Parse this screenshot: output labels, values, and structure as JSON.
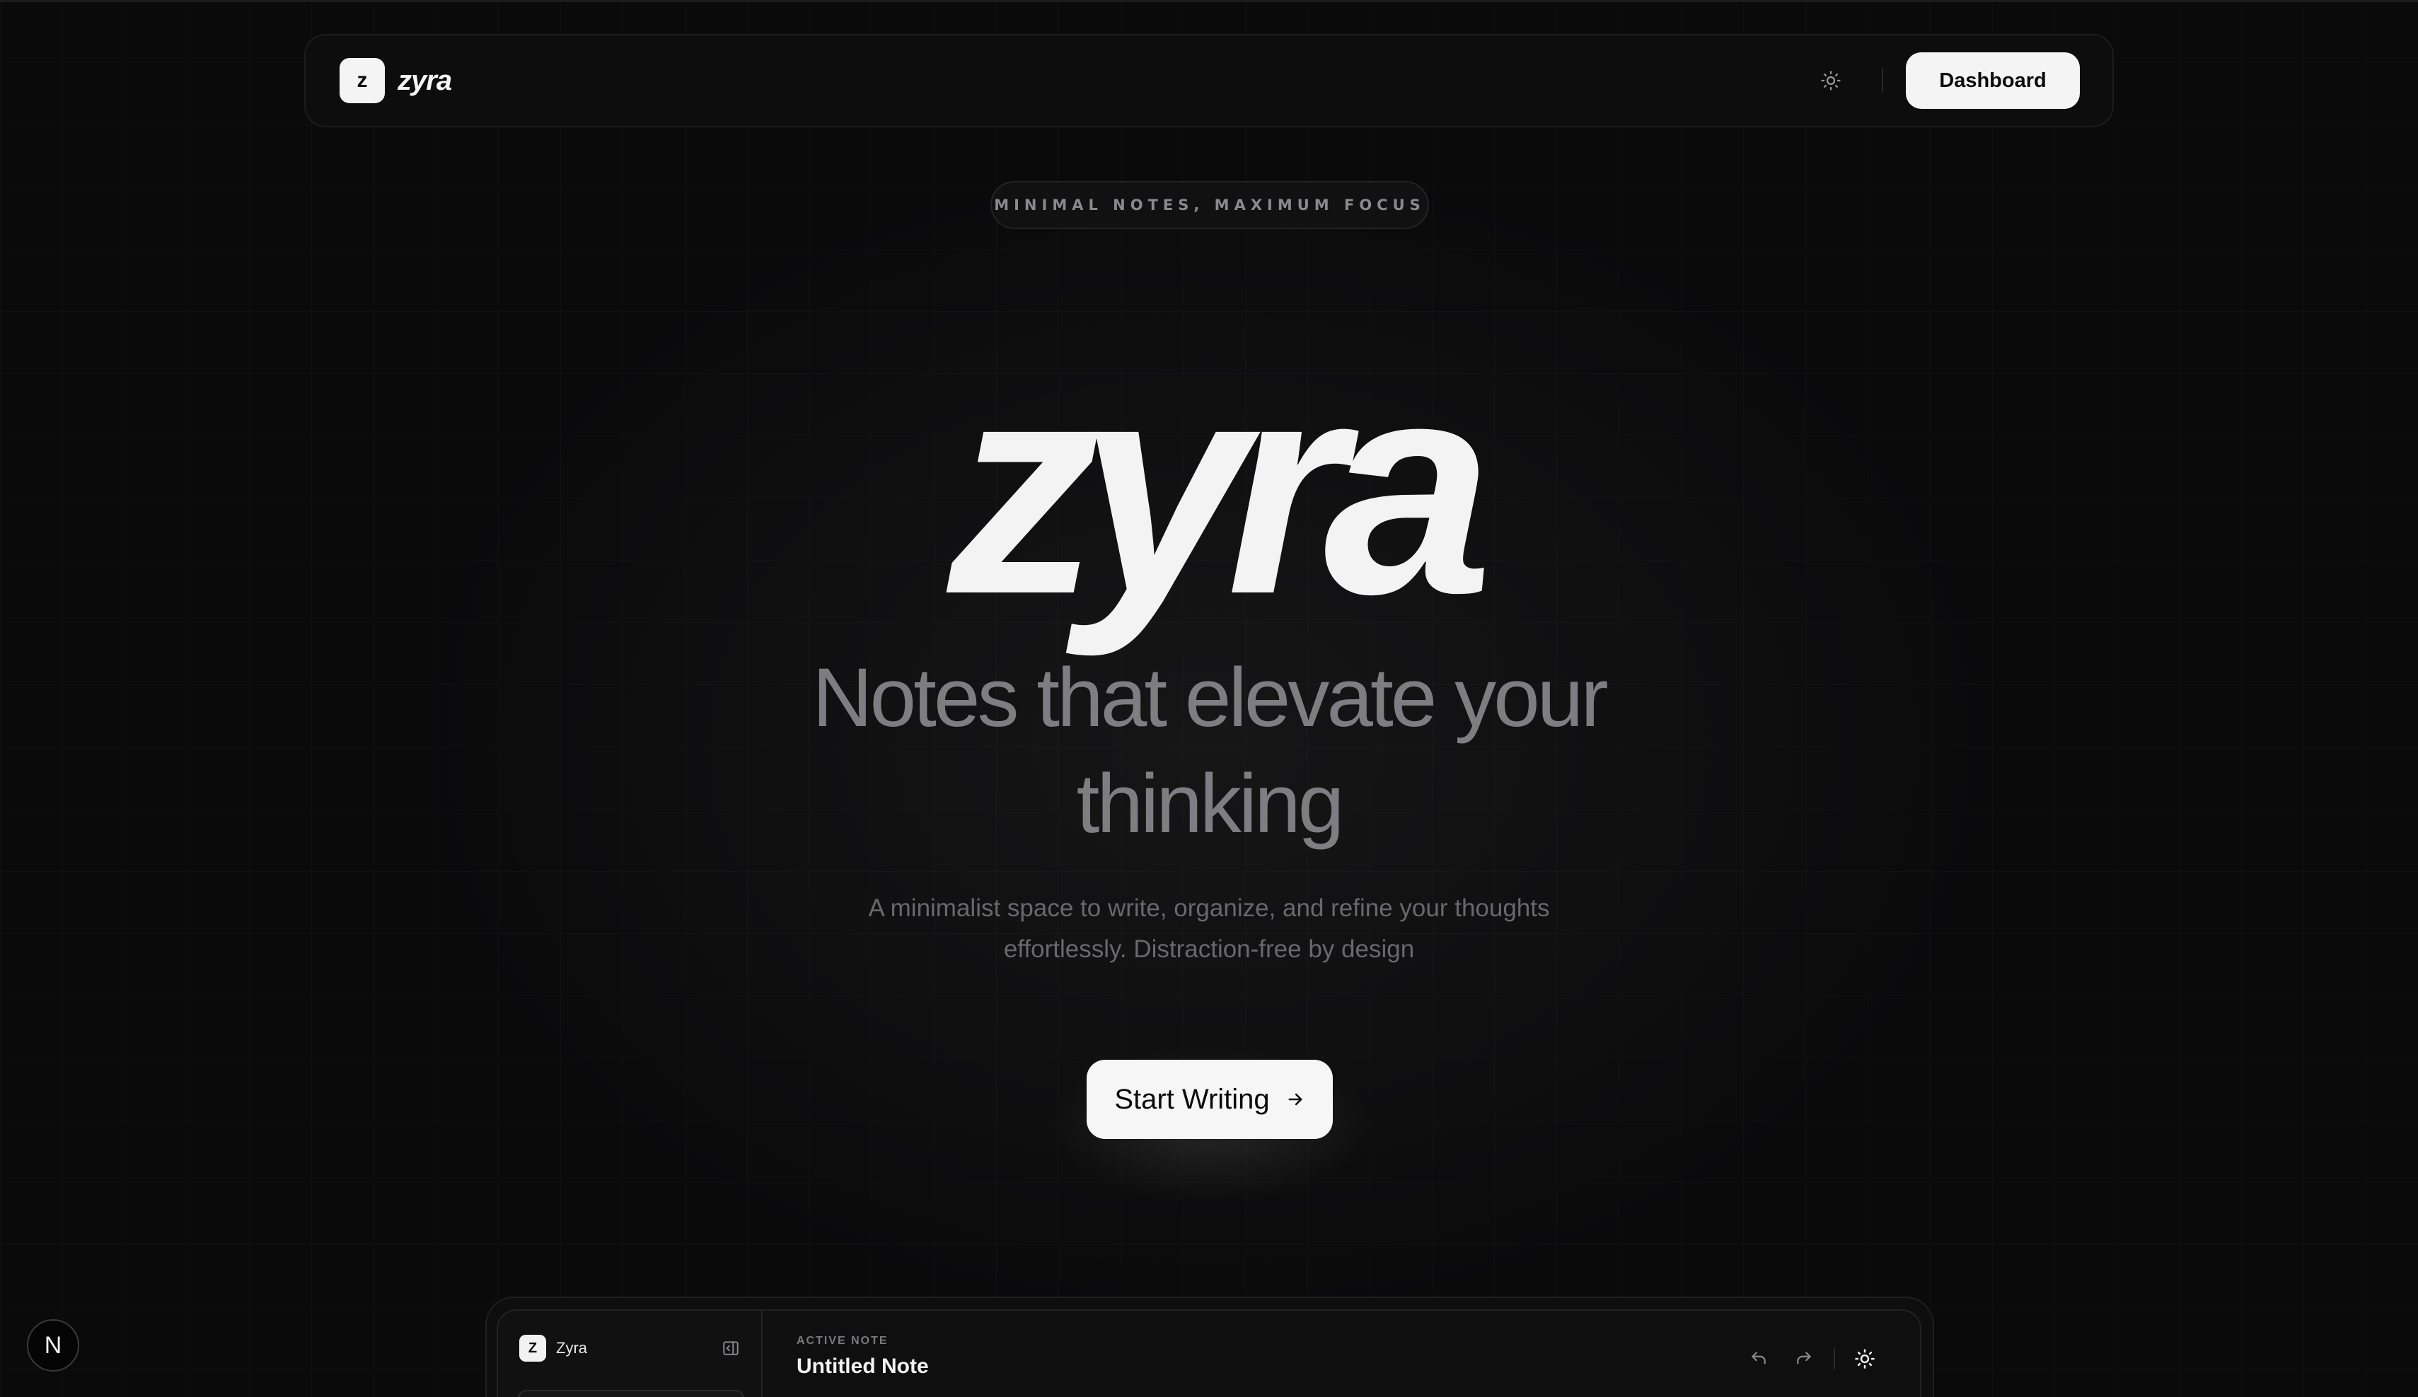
{
  "nav": {
    "logo_letter": "z",
    "brand_name": "zyra",
    "theme_icon": "sun-icon",
    "dashboard_label": "Dashboard"
  },
  "hero": {
    "badge": "MINIMAL NOTES, MAXIMUM FOCUS",
    "wordmark": "zyra",
    "headline_line1": "Notes that elevate your",
    "headline_line2": "thinking",
    "subtext_line1": "A minimalist space to write, organize, and refine your thoughts",
    "subtext_line2": "effortlessly. Distraction-free by design",
    "cta_label": "Start Writing",
    "cta_icon": "arrow-right-icon"
  },
  "preview": {
    "sidebar": {
      "logo_letter": "Z",
      "app_name": "Zyra",
      "toggle_icon": "sidebar-collapse-icon"
    },
    "main": {
      "active_label": "ACTIVE NOTE",
      "note_title": "Untitled Note",
      "undo_icon": "undo-icon",
      "redo_icon": "redo-icon",
      "theme_icon": "sun-icon"
    }
  },
  "floating_badge": {
    "letter": "N"
  },
  "colors": {
    "background": "#0b0b0c",
    "foreground": "#f3f3f3",
    "muted_headline": "#7d7d82",
    "muted_text": "#68686d"
  }
}
